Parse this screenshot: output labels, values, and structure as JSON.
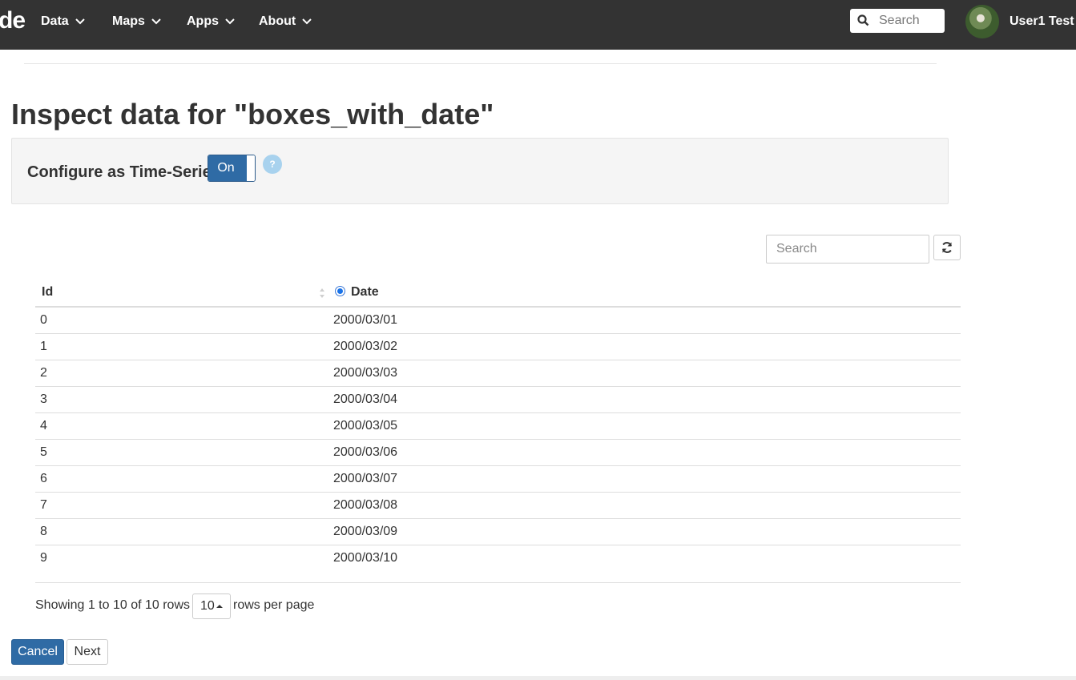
{
  "navbar": {
    "brand": "de",
    "items": [
      {
        "label": "Data"
      },
      {
        "label": "Maps"
      },
      {
        "label": "Apps"
      },
      {
        "label": "About"
      }
    ],
    "search_placeholder": "Search",
    "user_name": "User1 Test"
  },
  "page": {
    "title": "Inspect data for \"boxes_with_date\"",
    "timeseries_label": "Configure as Time-Series",
    "toggle_label": "On",
    "help_label": "?"
  },
  "table": {
    "search_placeholder": "Search",
    "columns": [
      "Id",
      "Date"
    ],
    "selected_column": "Date",
    "rows": [
      {
        "id": "0",
        "date": "2000/03/01"
      },
      {
        "id": "1",
        "date": "2000/03/02"
      },
      {
        "id": "2",
        "date": "2000/03/03"
      },
      {
        "id": "3",
        "date": "2000/03/04"
      },
      {
        "id": "4",
        "date": "2000/03/05"
      },
      {
        "id": "5",
        "date": "2000/03/06"
      },
      {
        "id": "6",
        "date": "2000/03/07"
      },
      {
        "id": "7",
        "date": "2000/03/08"
      },
      {
        "id": "8",
        "date": "2000/03/09"
      },
      {
        "id": "9",
        "date": "2000/03/10"
      }
    ]
  },
  "pagination": {
    "info": "Showing 1 to 10 of 10 rows",
    "page_size": "10",
    "suffix": "rows per page"
  },
  "actions": {
    "cancel": "Cancel",
    "next": "Next"
  }
}
